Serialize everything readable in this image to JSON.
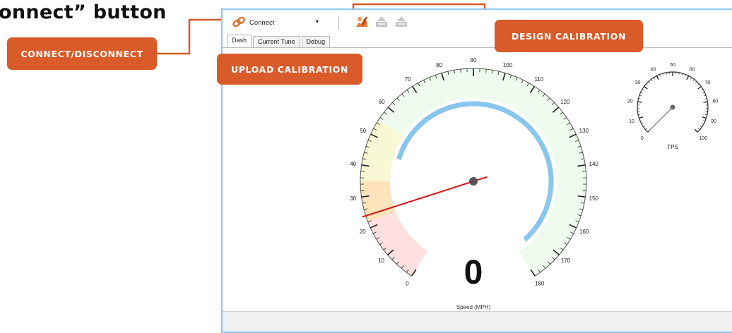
{
  "annotations": {
    "heading": "onnect” button",
    "connect_disconnect": "CONNECT/DISCONNECT",
    "upload_calibration": "UPLOAD CALIBRATION",
    "design_calibration": "DESIGN CALIBRATION"
  },
  "colors": {
    "callout": "#d95b2a",
    "window_border": "#8fc8ef",
    "needle": "#e01010",
    "progress_arc": "#88c6ee"
  },
  "toolbar": {
    "connect_label": "Connect",
    "dropdown_value": "",
    "icons": [
      "chain-link-icon",
      "design-calibration-icon",
      "upload-calibration-icon",
      "download-calibration-icon"
    ]
  },
  "tabs": [
    "Dash",
    "Current Tune",
    "Debug"
  ],
  "active_tab": "Dash",
  "speed_gauge": {
    "label": "Speed (MPH)",
    "readout": "0",
    "min": 0,
    "max": 180,
    "major_step": 10,
    "needle_value": 24,
    "progress_value_range": [
      45,
      175
    ],
    "bands": [
      {
        "from": 0,
        "to": 22,
        "color": "#ffe0e0"
      },
      {
        "from": 22,
        "to": 35,
        "color": "#ffe3bb"
      },
      {
        "from": 35,
        "to": 55,
        "color": "#f8f9d4"
      },
      {
        "from": 55,
        "to": 180,
        "color": "#effbef"
      }
    ]
  },
  "tps_gauge": {
    "label": "TPS",
    "min": 0,
    "max": 100,
    "major_step": 10,
    "needle_value": 0
  }
}
